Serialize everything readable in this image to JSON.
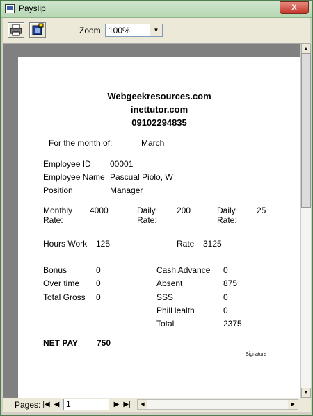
{
  "window": {
    "title": "Payslip",
    "close_label": "X"
  },
  "toolbar": {
    "zoom_label": "Zoom",
    "zoom_value": "100%"
  },
  "report": {
    "company": "Webgeekresources.com",
    "website": "inettutor.com",
    "phone": "09102294835",
    "month_label": "For the month of:",
    "month_value": "March",
    "employee_id_label": "Employee ID",
    "employee_id_value": "00001",
    "employee_name_label": "Employee Name",
    "employee_name_value": "Pascual Piolo, W",
    "position_label": "Position",
    "position_value": "Manager",
    "monthly_rate_label_1": "Monthly",
    "monthly_rate_label_2": "Rate:",
    "monthly_rate_value": "4000",
    "daily_rate_label_1": "Daily",
    "daily_rate_label_2": "Rate:",
    "daily_rate_value": "200",
    "daily_rate2_label_1": "Daily",
    "daily_rate2_label_2": "Rate:",
    "daily_rate2_value": "25",
    "hours_work_label": "Hours Work",
    "hours_work_value": "125",
    "rate_label": "Rate",
    "rate_value": "3125",
    "bonus_label": "Bonus",
    "bonus_value": "0",
    "overtime_label": "Over time",
    "overtime_value": "0",
    "total_gross_label": "Total Gross",
    "total_gross_value": "0",
    "cash_advance_label": "Cash Advance",
    "cash_advance_value": "0",
    "absent_label": "Absent",
    "absent_value": "875",
    "sss_label": "SSS",
    "sss_value": "0",
    "philhealth_label": "PhilHealth",
    "philhealth_value": "0",
    "total_label": "Total",
    "total_value": "2375",
    "net_pay_label": "NET PAY",
    "net_pay_value": "750",
    "signature_label": "Signature"
  },
  "statusbar": {
    "pages_label": "Pages:",
    "page_value": "1"
  }
}
